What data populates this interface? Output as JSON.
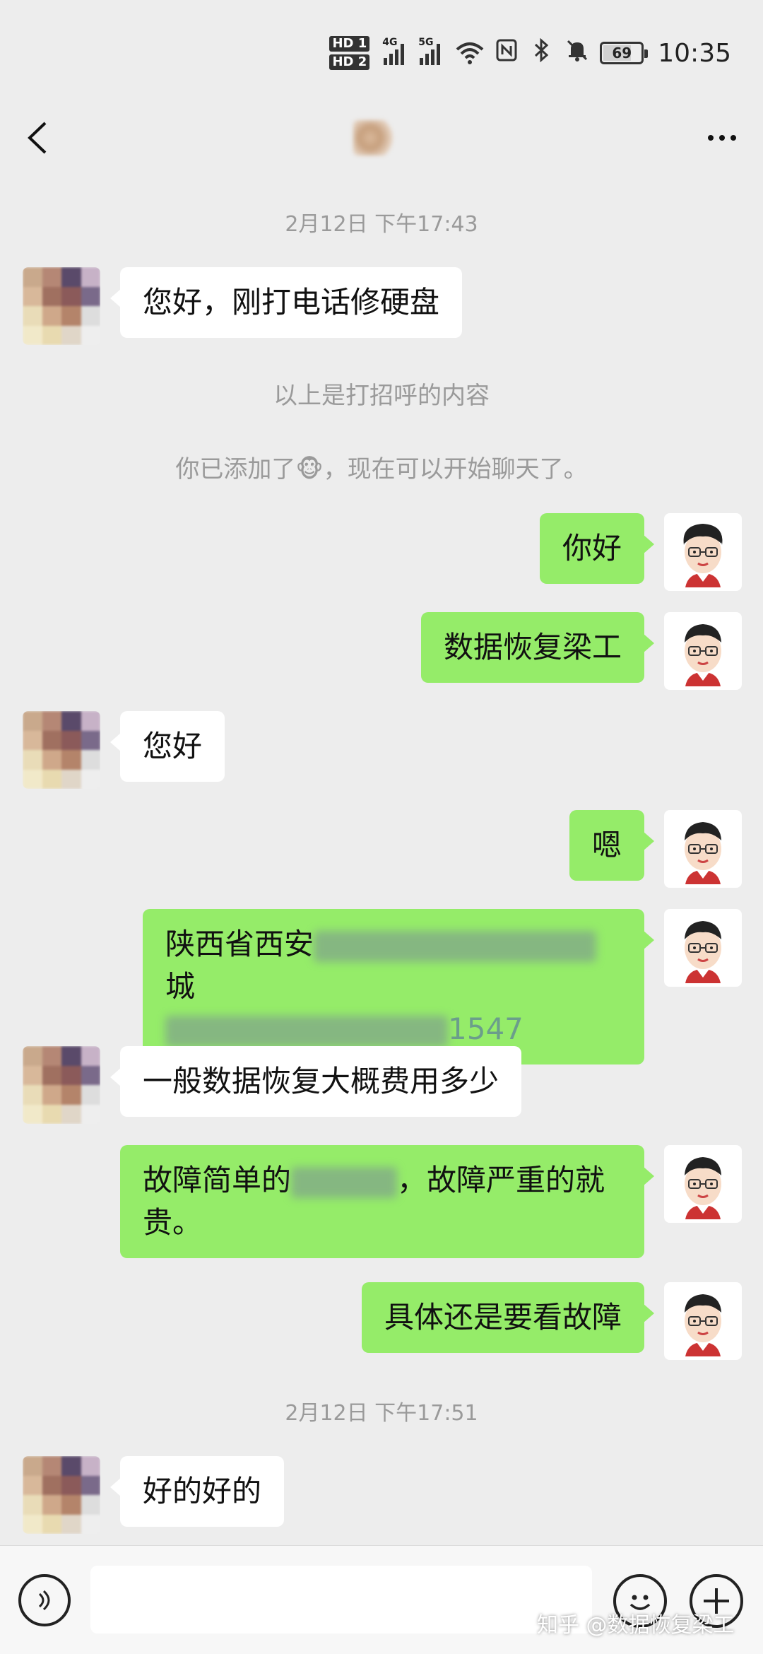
{
  "status_bar": {
    "hd1": "HD 1",
    "hd2": "HD 2",
    "net1": "4G",
    "net2": "5G",
    "battery": "69",
    "time": "10:35"
  },
  "header": {
    "back_icon": "chevron-left-icon",
    "more_icon": "more-dots-icon"
  },
  "messages": {
    "ts1": "2月12日 下午17:43",
    "m1": "您好，刚打电话修硬盘",
    "sys1": "以上是打招呼的内容",
    "sys2_prefix": "你已添加了",
    "sys2_emoji": "🐵",
    "sys2_suffix": "，现在可以开始聊天了。",
    "m2": "你好",
    "m3": "数据恢复梁工",
    "m4": "您好",
    "m5": "嗯",
    "m6_line1_visible": "陕西省西安",
    "m6_line1_tail": "城",
    "m6_line2_tail": "1547",
    "m7": "一般数据恢复大概费用多少",
    "m8_part1": "故障简单的",
    "m8_part2": "，故障严重的就",
    "m8_line2": "贵。",
    "m9": "具体还是要看故障",
    "ts2": "2月12日 下午17:51",
    "m10": "好的好的"
  },
  "input_bar": {
    "placeholder": "",
    "watermark": "知乎 @数据恢复梁工"
  }
}
